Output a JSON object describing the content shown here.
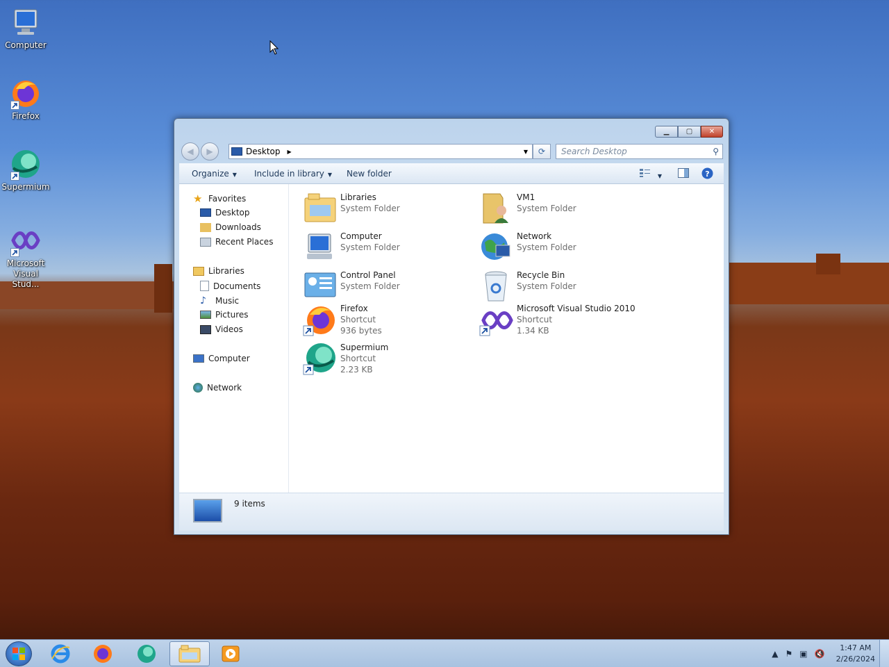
{
  "desktop": {
    "icons": [
      {
        "label": "Computer"
      },
      {
        "label": "Firefox"
      },
      {
        "label": "Supermium"
      },
      {
        "label": "Microsoft Visual Stud..."
      }
    ]
  },
  "window": {
    "address": {
      "location": "Desktop"
    },
    "search": {
      "placeholder": "Search Desktop"
    },
    "toolbar": {
      "organize": "Organize",
      "include_in_library": "Include in library",
      "new_folder": "New folder"
    },
    "nav": {
      "favorites": "Favorites",
      "desktop": "Desktop",
      "downloads": "Downloads",
      "recent_places": "Recent Places",
      "libraries": "Libraries",
      "documents": "Documents",
      "music": "Music",
      "pictures": "Pictures",
      "videos": "Videos",
      "computer": "Computer",
      "network": "Network"
    },
    "files": [
      {
        "name": "Libraries",
        "type": "System Folder",
        "size": ""
      },
      {
        "name": "VM1",
        "type": "System Folder",
        "size": ""
      },
      {
        "name": "Computer",
        "type": "System Folder",
        "size": ""
      },
      {
        "name": "Network",
        "type": "System Folder",
        "size": ""
      },
      {
        "name": "Control Panel",
        "type": "System Folder",
        "size": ""
      },
      {
        "name": "Recycle Bin",
        "type": "System Folder",
        "size": ""
      },
      {
        "name": "Firefox",
        "type": "Shortcut",
        "size": "936 bytes"
      },
      {
        "name": "Microsoft Visual Studio 2010",
        "type": "Shortcut",
        "size": "1.34 KB"
      },
      {
        "name": "Supermium",
        "type": "Shortcut",
        "size": "2.23 KB"
      }
    ],
    "status": {
      "count": "9 items"
    }
  },
  "taskbar": {
    "clock": {
      "time": "1:47 AM",
      "date": "2/26/2024"
    }
  }
}
